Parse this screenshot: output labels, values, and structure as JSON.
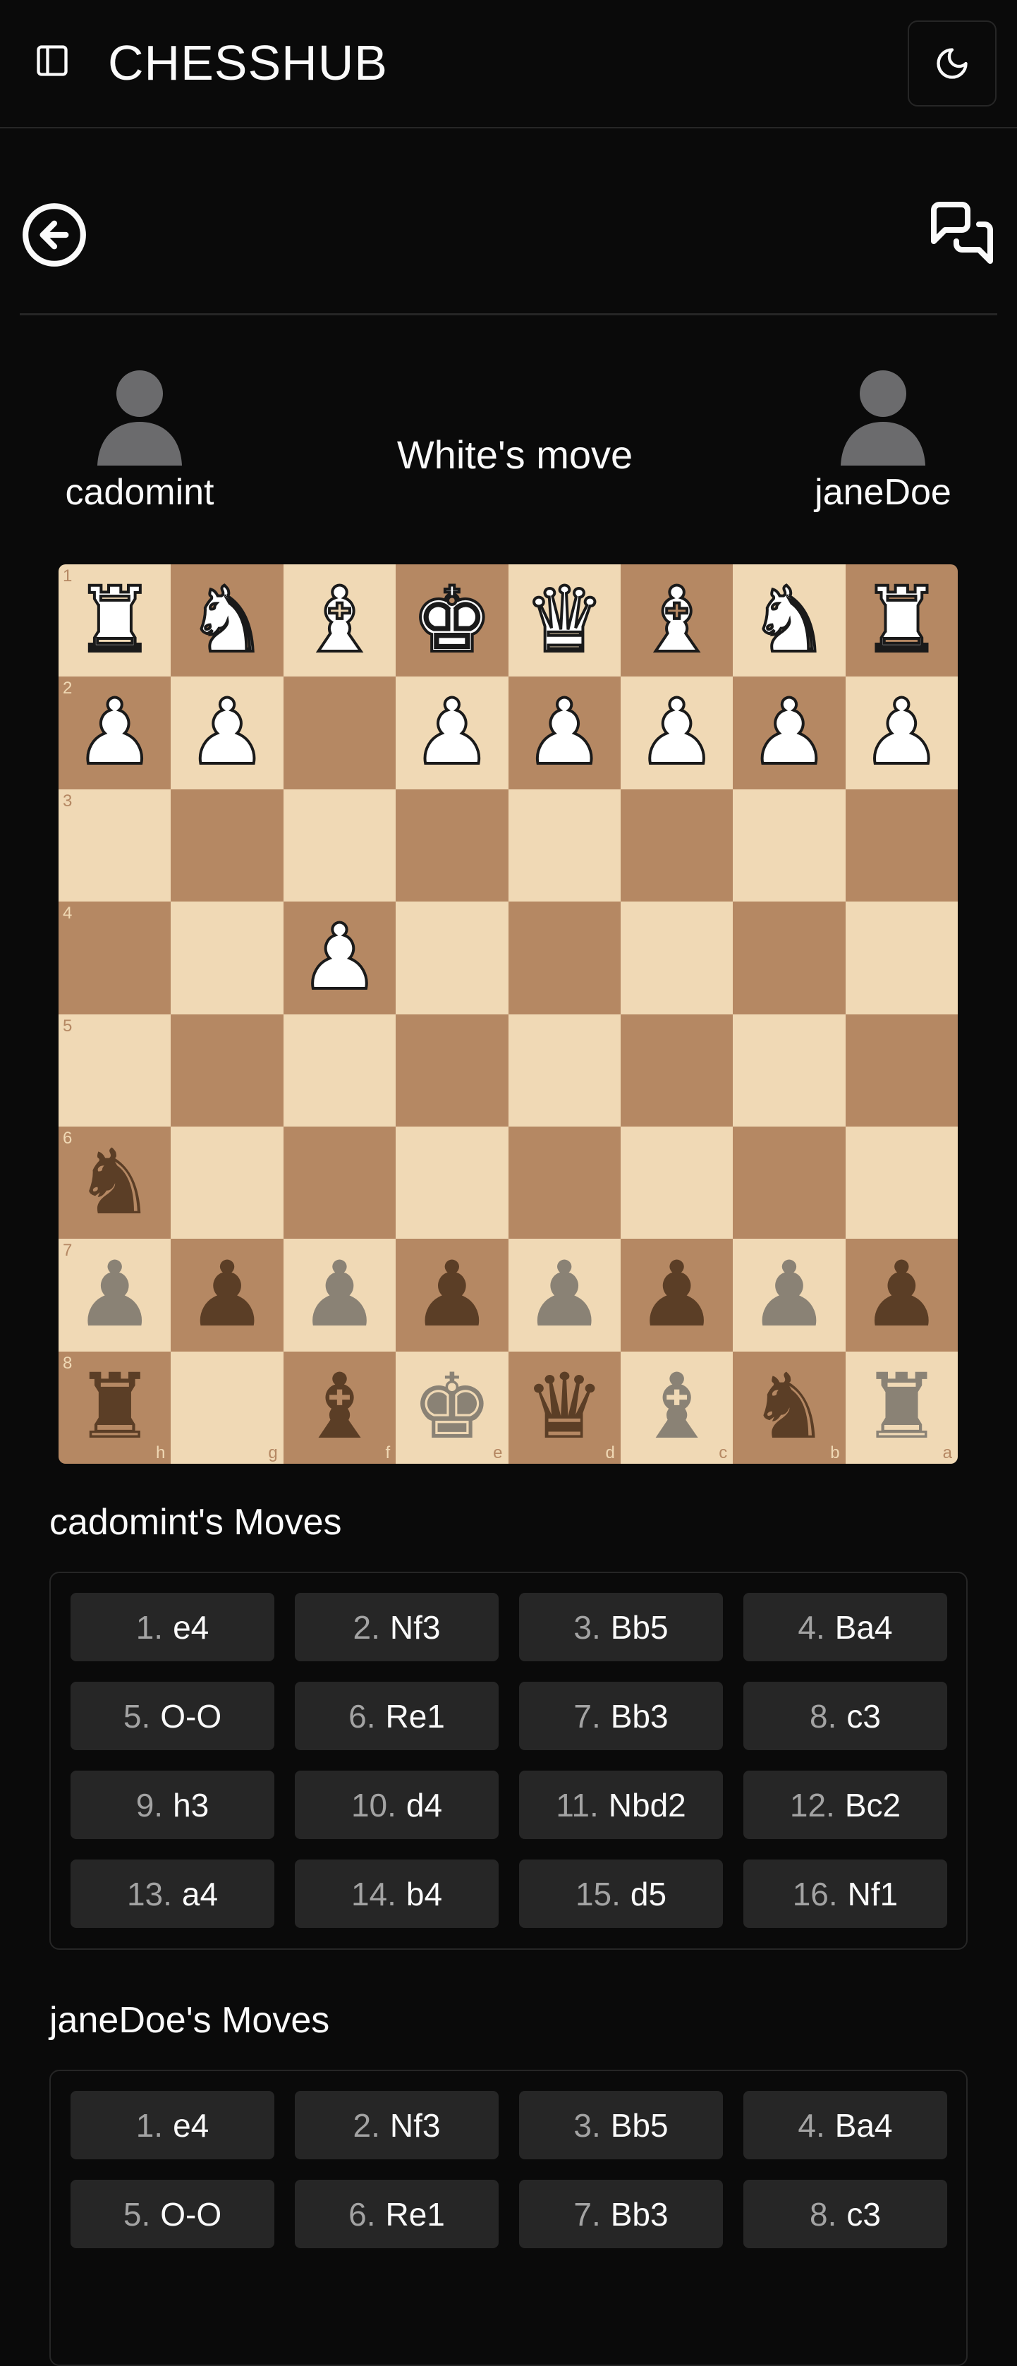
{
  "header": {
    "app_title": "CHESSHUB",
    "icons": {
      "sidebar_toggle": "panel-left-icon",
      "theme_toggle": "moon-icon"
    }
  },
  "toolbar": {
    "back_icon": "arrow-left-circle-icon",
    "chat_icon": "messages-icon"
  },
  "game": {
    "status": "White's move",
    "players": {
      "left": "cadomint",
      "right": "janeDoe"
    }
  },
  "board": {
    "ranks": [
      "1",
      "2",
      "3",
      "4",
      "5",
      "6",
      "7",
      "8"
    ],
    "files": [
      "h",
      "g",
      "f",
      "e",
      "d",
      "c",
      "b",
      "a"
    ],
    "pieces": [
      [
        "wR",
        "wN",
        "wB",
        "wK",
        "wQ",
        "wB",
        "wN",
        "wR"
      ],
      [
        "wP",
        "wP",
        "",
        "wP",
        "wP",
        "wP",
        "wP",
        "wP"
      ],
      [
        "",
        "",
        "",
        "",
        "",
        "",
        "",
        ""
      ],
      [
        "",
        "",
        "wP",
        "",
        "",
        "",
        "",
        ""
      ],
      [
        "",
        "",
        "",
        "",
        "",
        "",
        "",
        ""
      ],
      [
        "bN",
        "",
        "",
        "",
        "",
        "",
        "",
        ""
      ],
      [
        "bP*",
        "bP",
        "bP*",
        "bP",
        "bP*",
        "bP",
        "bP*",
        "bP"
      ],
      [
        "bR",
        "",
        "bB",
        "bK*",
        "bQ",
        "bB*",
        "bN",
        "bR*"
      ]
    ]
  },
  "moves": {
    "cadomint": {
      "title": "cadomint's Moves",
      "list": [
        {
          "num": "1.",
          "san": "e4"
        },
        {
          "num": "2.",
          "san": "Nf3"
        },
        {
          "num": "3.",
          "san": "Bb5"
        },
        {
          "num": "4.",
          "san": "Ba4"
        },
        {
          "num": "5.",
          "san": "O-O"
        },
        {
          "num": "6.",
          "san": "Re1"
        },
        {
          "num": "7.",
          "san": "Bb3"
        },
        {
          "num": "8.",
          "san": "c3"
        },
        {
          "num": "9.",
          "san": "h3"
        },
        {
          "num": "10.",
          "san": "d4"
        },
        {
          "num": "11.",
          "san": "Nbd2"
        },
        {
          "num": "12.",
          "san": "Bc2"
        },
        {
          "num": "13.",
          "san": "a4"
        },
        {
          "num": "14.",
          "san": "b4"
        },
        {
          "num": "15.",
          "san": "d5"
        },
        {
          "num": "16.",
          "san": "Nf1"
        }
      ]
    },
    "janeDoe": {
      "title": "janeDoe's Moves",
      "list": [
        {
          "num": "1.",
          "san": "e4"
        },
        {
          "num": "2.",
          "san": "Nf3"
        },
        {
          "num": "3.",
          "san": "Bb5"
        },
        {
          "num": "4.",
          "san": "Ba4"
        },
        {
          "num": "5.",
          "san": "O-O"
        },
        {
          "num": "6.",
          "san": "Re1"
        },
        {
          "num": "7.",
          "san": "Bb3"
        },
        {
          "num": "8.",
          "san": "c3"
        }
      ]
    }
  },
  "colors": {
    "background": "#0a0a0a",
    "border": "#262626",
    "light_square": "#f0d9b5",
    "dark_square": "#b58863",
    "move_chip": "#262626",
    "muted_text": "#a3a3a3"
  }
}
